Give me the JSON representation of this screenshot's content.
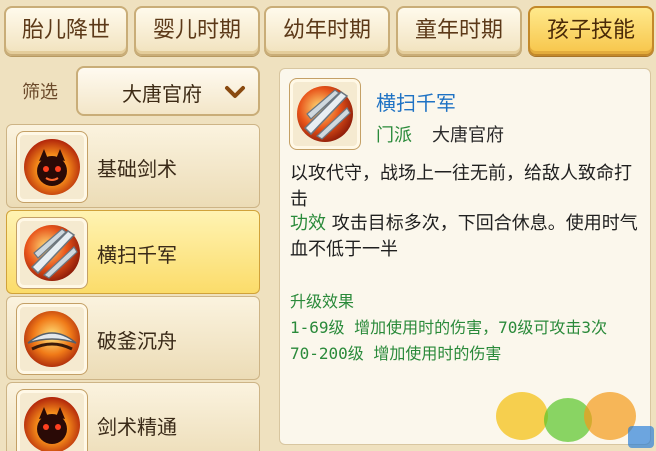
{
  "tabs": [
    {
      "label": "胎儿降世",
      "active": false
    },
    {
      "label": "婴儿时期",
      "active": false
    },
    {
      "label": "幼年时期",
      "active": false
    },
    {
      "label": "童年时期",
      "active": false
    },
    {
      "label": "孩子技能",
      "active": true
    }
  ],
  "filter": {
    "label": "筛选",
    "selected": "大唐官府"
  },
  "skills": [
    {
      "name": "基础剑术",
      "icon": "demon-face-icon"
    },
    {
      "name": "横扫千军",
      "icon": "slash-strike-icon",
      "selected": true
    },
    {
      "name": "破釜沉舟",
      "icon": "boomerang-blade-icon"
    },
    {
      "name": "剑术精通",
      "icon": "demon-face-icon"
    }
  ],
  "detail": {
    "title": "横扫千军",
    "school_label": "门派",
    "school_value": "大唐官府",
    "description": "以攻代守，战场上一往无前，给敌人致命打击",
    "effect_label": "功效",
    "effect_text": "攻击目标多次，下回合休息。使用时气血不低于一半",
    "upgrade_title": "升级效果",
    "upgrade_lines": [
      "1-69级 增加使用时的伤害，70级可攻击3次",
      "70-200级 增加使用时的伤害"
    ]
  },
  "colors": {
    "background": "#efe1bf",
    "active_tab": "#f7c54a",
    "title_blue": "#1e72c4",
    "label_green": "#2a8a3a"
  }
}
